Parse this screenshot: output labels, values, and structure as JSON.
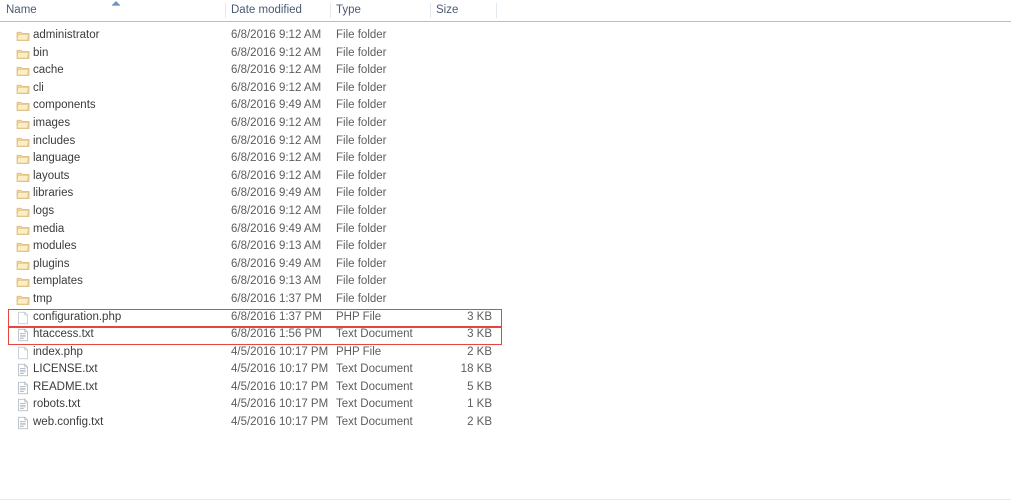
{
  "header": {
    "columns": [
      {
        "label": "Name",
        "key": "name"
      },
      {
        "label": "Date modified",
        "key": "date"
      },
      {
        "label": "Type",
        "key": "type"
      },
      {
        "label": "Size",
        "key": "size"
      }
    ],
    "sort_column": "Name",
    "sort_direction": "ascending",
    "sort_icon": "sort-ascending-arrow-icon"
  },
  "colors": {
    "highlight": "#e8453c",
    "header_text": "#4a5a73",
    "header_rule": "#b6bdc6",
    "folder_icon": "#f0d08a",
    "row_text": "#3b3b3b"
  },
  "rows": [
    {
      "name": "administrator",
      "date": "6/8/2016 9:12 AM",
      "type": "File folder",
      "size": "",
      "icon": "folder-icon",
      "highlighted": false
    },
    {
      "name": "bin",
      "date": "6/8/2016 9:12 AM",
      "type": "File folder",
      "size": "",
      "icon": "folder-icon",
      "highlighted": false
    },
    {
      "name": "cache",
      "date": "6/8/2016 9:12 AM",
      "type": "File folder",
      "size": "",
      "icon": "folder-icon",
      "highlighted": false
    },
    {
      "name": "cli",
      "date": "6/8/2016 9:12 AM",
      "type": "File folder",
      "size": "",
      "icon": "folder-icon",
      "highlighted": false
    },
    {
      "name": "components",
      "date": "6/8/2016 9:49 AM",
      "type": "File folder",
      "size": "",
      "icon": "folder-icon",
      "highlighted": false
    },
    {
      "name": "images",
      "date": "6/8/2016 9:12 AM",
      "type": "File folder",
      "size": "",
      "icon": "folder-icon",
      "highlighted": false
    },
    {
      "name": "includes",
      "date": "6/8/2016 9:12 AM",
      "type": "File folder",
      "size": "",
      "icon": "folder-icon",
      "highlighted": false
    },
    {
      "name": "language",
      "date": "6/8/2016 9:12 AM",
      "type": "File folder",
      "size": "",
      "icon": "folder-icon",
      "highlighted": false
    },
    {
      "name": "layouts",
      "date": "6/8/2016 9:12 AM",
      "type": "File folder",
      "size": "",
      "icon": "folder-icon",
      "highlighted": false
    },
    {
      "name": "libraries",
      "date": "6/8/2016 9:49 AM",
      "type": "File folder",
      "size": "",
      "icon": "folder-icon",
      "highlighted": false
    },
    {
      "name": "logs",
      "date": "6/8/2016 9:12 AM",
      "type": "File folder",
      "size": "",
      "icon": "folder-icon",
      "highlighted": false
    },
    {
      "name": "media",
      "date": "6/8/2016 9:49 AM",
      "type": "File folder",
      "size": "",
      "icon": "folder-icon",
      "highlighted": false
    },
    {
      "name": "modules",
      "date": "6/8/2016 9:13 AM",
      "type": "File folder",
      "size": "",
      "icon": "folder-icon",
      "highlighted": false
    },
    {
      "name": "plugins",
      "date": "6/8/2016 9:49 AM",
      "type": "File folder",
      "size": "",
      "icon": "folder-icon",
      "highlighted": false
    },
    {
      "name": "templates",
      "date": "6/8/2016 9:13 AM",
      "type": "File folder",
      "size": "",
      "icon": "folder-icon",
      "highlighted": false
    },
    {
      "name": "tmp",
      "date": "6/8/2016 1:37 PM",
      "type": "File folder",
      "size": "",
      "icon": "folder-icon",
      "highlighted": false
    },
    {
      "name": "configuration.php",
      "date": "6/8/2016 1:37 PM",
      "type": "PHP File",
      "size": "3 KB",
      "icon": "php-file-icon",
      "highlighted": true
    },
    {
      "name": "htaccess.txt",
      "date": "6/8/2016 1:56 PM",
      "type": "Text Document",
      "size": "3 KB",
      "icon": "text-file-icon",
      "highlighted": true
    },
    {
      "name": "index.php",
      "date": "4/5/2016 10:17 PM",
      "type": "PHP File",
      "size": "2 KB",
      "icon": "php-file-icon",
      "highlighted": false
    },
    {
      "name": "LICENSE.txt",
      "date": "4/5/2016 10:17 PM",
      "type": "Text Document",
      "size": "18 KB",
      "icon": "text-file-icon",
      "highlighted": false
    },
    {
      "name": "README.txt",
      "date": "4/5/2016 10:17 PM",
      "type": "Text Document",
      "size": "5 KB",
      "icon": "text-file-icon",
      "highlighted": false
    },
    {
      "name": "robots.txt",
      "date": "4/5/2016 10:17 PM",
      "type": "Text Document",
      "size": "1 KB",
      "icon": "text-file-icon",
      "highlighted": false
    },
    {
      "name": "web.config.txt",
      "date": "4/5/2016 10:17 PM",
      "type": "Text Document",
      "size": "2 KB",
      "icon": "text-file-icon",
      "highlighted": false
    }
  ]
}
